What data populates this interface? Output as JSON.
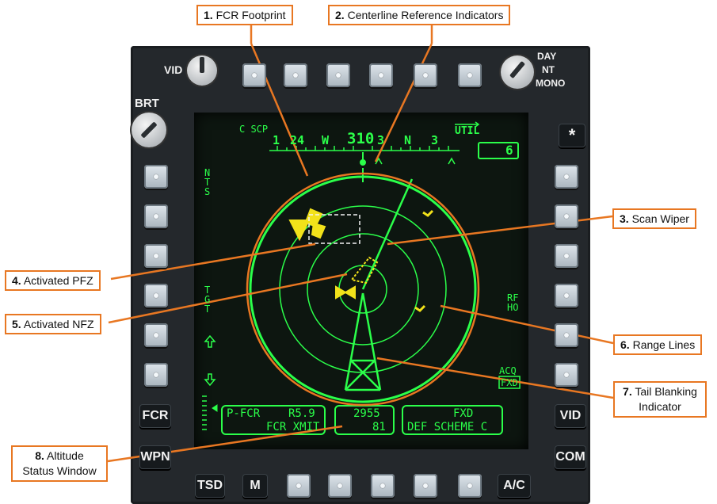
{
  "callouts": [
    {
      "num": "1.",
      "text": "FCR Footprint"
    },
    {
      "num": "2.",
      "text": "Centerline Reference Indicators"
    },
    {
      "num": "3.",
      "text": "Scan Wiper"
    },
    {
      "num": "4.",
      "text": "Activated PFZ"
    },
    {
      "num": "5.",
      "text": "Activated NFZ"
    },
    {
      "num": "6.",
      "text": "Range Lines"
    },
    {
      "num": "7.",
      "text": "Tail Blanking",
      "text2": "Indicator"
    },
    {
      "num": "8.",
      "text": "Altitude",
      "text2": "Status Window"
    }
  ],
  "bezel": {
    "vid_knob": "VID",
    "brt": "BRT",
    "day": "DAY",
    "nt": "NT",
    "mono": "MONO",
    "star": "*",
    "left_buttons": [
      "FCR",
      "WPN"
    ],
    "right_buttons": [
      "VID",
      "COM"
    ],
    "bottom_buttons": [
      "TSD",
      "M",
      "A/C"
    ]
  },
  "display": {
    "c_scp": "C SCP",
    "heading_tape": [
      "1",
      "24",
      "W",
      "310",
      "3",
      "N",
      "3"
    ],
    "util": "UTIL",
    "page_box": "6",
    "left_labels": {
      "nts": "NTS",
      "tgt": "TGT"
    },
    "right_labels": {
      "rf": "RF",
      "ho": "HO",
      "acq": "ACQ",
      "fxd": "FXD"
    },
    "fcr_status": {
      "line1_left": "P-FCR",
      "line1_right": "R5.9",
      "line2": "FCR XMIT"
    },
    "altitude": {
      "line1": "2955",
      "line2": "81"
    },
    "scheme": {
      "line1": "FXD",
      "line2": "DEF SCHEME C"
    }
  },
  "colors": {
    "symbology": "#2bff4a",
    "threat": "#f2e21a",
    "callout": "#e87722",
    "screen": "#0d1610"
  }
}
